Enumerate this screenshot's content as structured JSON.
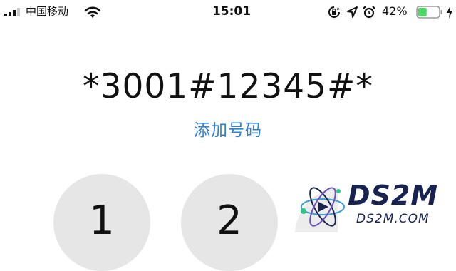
{
  "status_bar": {
    "carrier": "中国移动",
    "time": "15:01",
    "battery_percent": "42%",
    "battery_level": 0.42,
    "icons": [
      "signal-icon",
      "wifi-icon",
      "orientation-lock-icon",
      "location-icon",
      "alarm-icon",
      "battery-icon",
      "charging-icon"
    ]
  },
  "dialer": {
    "number": "*3001#12345#*",
    "add_number_label": "添加号码"
  },
  "keypad": {
    "keys": [
      "1",
      "2"
    ]
  },
  "watermark": {
    "title": "DS2M",
    "subtitle": "DS2M.COM"
  },
  "colors": {
    "link": "#2f80d9",
    "key_bg": "#e6e6e6",
    "battery_fill": "#4cd964",
    "watermark": "#18234f"
  }
}
